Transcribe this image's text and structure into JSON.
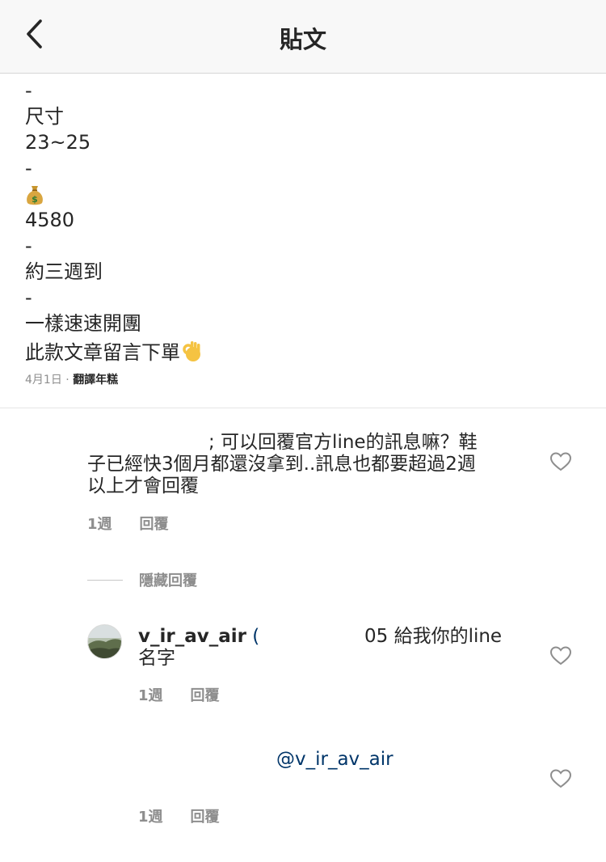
{
  "header": {
    "title": "貼文"
  },
  "caption": {
    "lines": [
      "-",
      "尺寸",
      "23~25",
      "-",
      "",
      "4580",
      "-",
      "約三週到",
      "-",
      "一樣速速開團",
      "此款文章留言下單"
    ]
  },
  "post_meta": {
    "date": "4月1日",
    "separator": " · ",
    "translate": "翻譯年糕"
  },
  "comments": [
    {
      "text_line1": "; 可以回覆官方line的訊息嘛？鞋",
      "text_line2": "子已經快3個月都還沒拿到..訊息也都要超過2週",
      "text_line3": "以上才會回覆",
      "time": "1週",
      "reply": "回覆"
    }
  ],
  "hide_replies": "隱藏回覆",
  "replies": [
    {
      "username": "v_ir_av_air",
      "text_start": "(",
      "text_tail": "05 給我你的line",
      "text_line2": "名字",
      "time": "1週",
      "reply": "回覆"
    },
    {
      "mention": "@v_ir_av_air",
      "time": "1週",
      "reply": "回覆"
    }
  ],
  "icons": {
    "back": "chevron-left-icon",
    "heart": "heart-outline-icon",
    "money_bag": "money-bag-emoji",
    "ok_hand": "ok-hand-emoji"
  },
  "colors": {
    "text": "#262626",
    "secondary": "#8e8e8e",
    "mention": "#003569",
    "header_bg": "#f8f8f8"
  }
}
